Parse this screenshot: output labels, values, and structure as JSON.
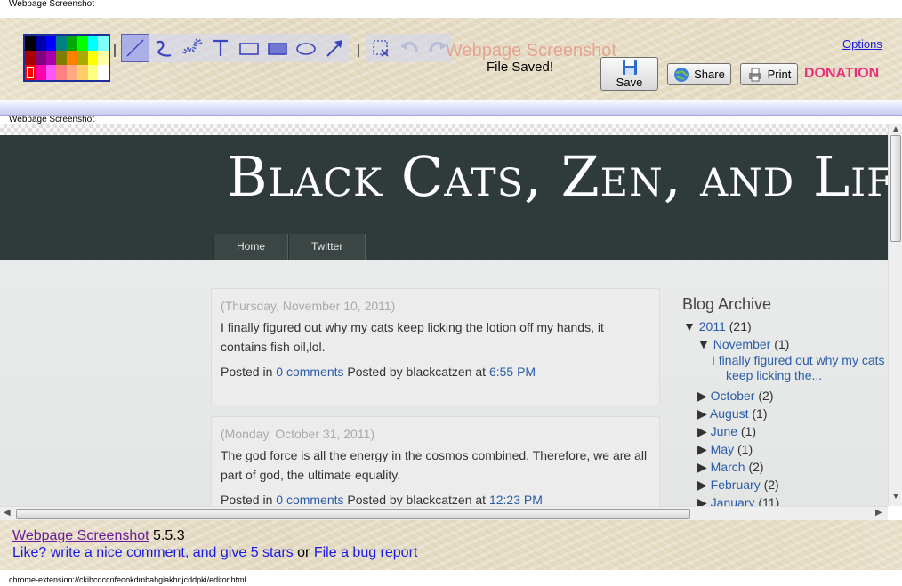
{
  "window_title": "Webpage Screenshot",
  "toolbar": {
    "palette_colors": [
      "#000000",
      "#0000aa",
      "#0000ff",
      "#008080",
      "#00aa00",
      "#00ff00",
      "#00ffff",
      "#80ffff",
      "#aa0000",
      "#800080",
      "#aa00aa",
      "#808000",
      "#ff8000",
      "#aaaa00",
      "#ffff00",
      "#ffffaa",
      "#ff0000",
      "#ff00aa",
      "#ff55ff",
      "#ff8080",
      "#ffaa80",
      "#ffcc66",
      "#ffff80",
      "#ffffff"
    ],
    "tools": [
      "line-tool-icon",
      "curve-tool-icon",
      "blur-tool-icon",
      "text-tool-icon",
      "rectangle-tool-icon",
      "filled-rectangle-tool-icon",
      "ellipse-tool-icon",
      "arrow-tool-icon"
    ],
    "ghost_title": "Webpage Screenshot",
    "status": "File Saved!",
    "save_label": "Save",
    "share_label": "Share",
    "print_label": "Print",
    "donation_label": "DONATION",
    "options_label": "Options"
  },
  "frame_label": "Webpage Screenshot",
  "blog": {
    "title": "Black Cats, Zen, and Life",
    "nav": [
      "Home",
      "Twitter"
    ],
    "posts": [
      {
        "date": "(Thursday, November 10, 2011)",
        "body": "I finally figured out why my cats keep licking the lotion off my hands, it contains fish oil,lol.",
        "posted_in": "Posted in",
        "comments": "0 comments",
        "posted_by": "Posted by blackcatzen at",
        "time": "6:55 PM"
      },
      {
        "date": "(Monday, October 31, 2011)",
        "body": "The god force is all the energy in the cosmos combined. Therefore, we are all part of god, the ultimate equality.",
        "posted_in": "Posted in",
        "comments": "0 comments",
        "posted_by": "Posted by blackcatzen at",
        "time": "12:23 PM"
      }
    ],
    "archive": {
      "heading": "Blog Archive",
      "year": "2011",
      "year_count": "(21)",
      "current_month": "November",
      "current_count": "(1)",
      "current_post_line1": "I finally figured out why my cats",
      "current_post_line2": "keep licking the...",
      "months": [
        {
          "name": "October",
          "count": "(2)"
        },
        {
          "name": "August",
          "count": "(1)"
        },
        {
          "name": "June",
          "count": "(1)"
        },
        {
          "name": "May",
          "count": "(1)"
        },
        {
          "name": "March",
          "count": "(2)"
        },
        {
          "name": "February",
          "count": "(2)"
        },
        {
          "name": "January",
          "count": "(11)"
        }
      ]
    }
  },
  "footer": {
    "app_link": "Webpage Screenshot",
    "version": "5.5.3",
    "review_link": "Like? write a nice comment, and give 5 stars",
    "or_text": "or",
    "bug_link": "File a bug report"
  },
  "status_url": "chrome-extension://ckibcdccnfeookdmbahgiakhnjcddpki/editor.html"
}
